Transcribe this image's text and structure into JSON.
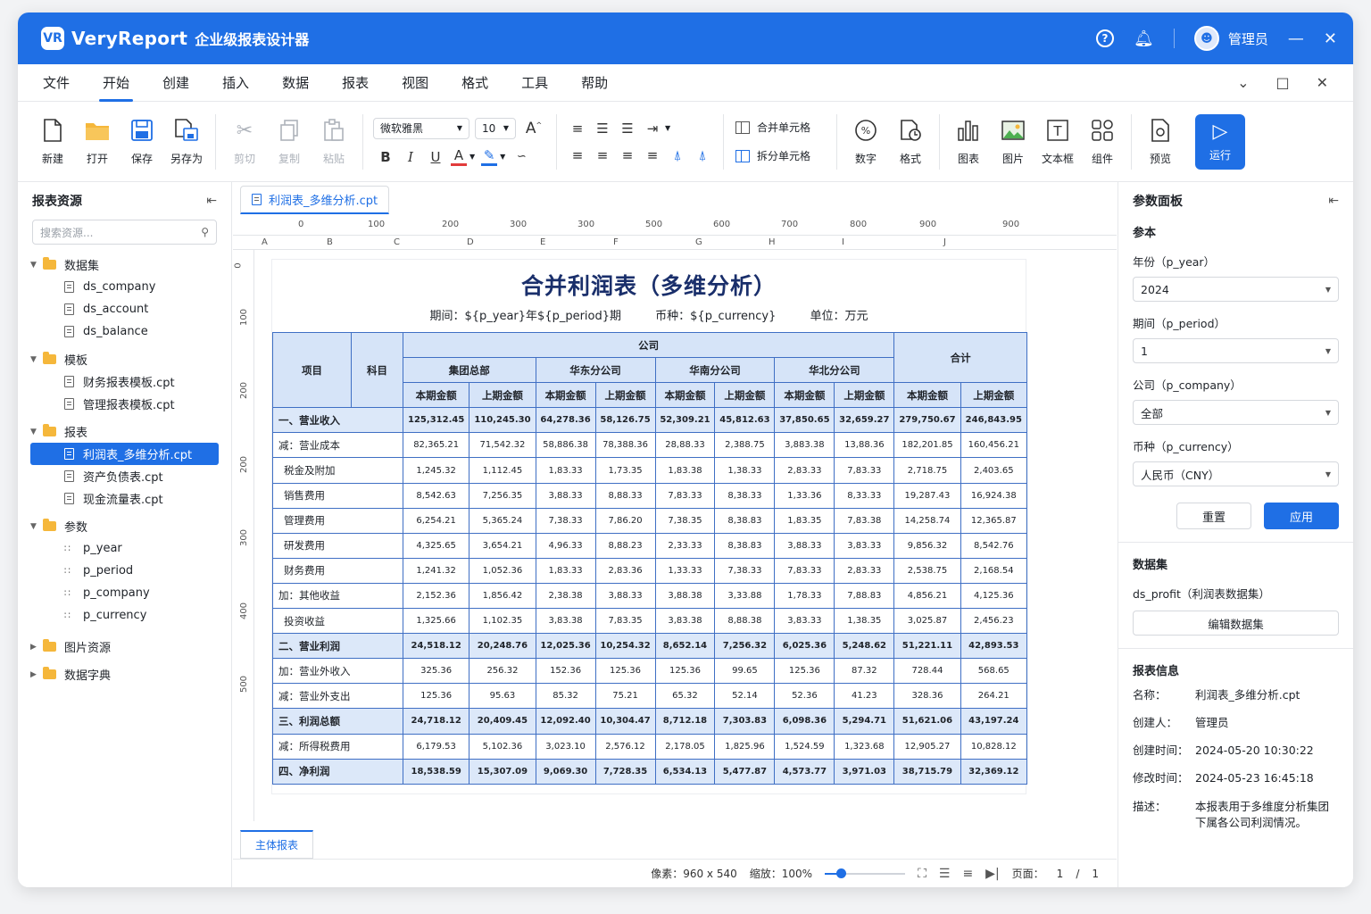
{
  "app": {
    "logo": "VR",
    "name": "VeryReport",
    "subtitle": "企业级报表设计器",
    "user": "管理员"
  },
  "menu": [
    "文件",
    "开始",
    "创建",
    "插入",
    "数据",
    "报表",
    "视图",
    "格式",
    "工具",
    "帮助"
  ],
  "ribbon": {
    "new": "新建",
    "open": "打开",
    "save": "保存",
    "save_as": "另存为",
    "cut": "剪切",
    "copy": "复制",
    "paste": "粘贴",
    "font_family": "微软雅黑",
    "font_size": "10",
    "merge": "合并单元格",
    "split": "拆分单元格",
    "number": "数字",
    "format": "格式",
    "chart": "图表",
    "image": "图片",
    "textbox": "文本框",
    "component": "组件",
    "preview": "预览",
    "run": "运行"
  },
  "left": {
    "title": "报表资源",
    "search_placeholder": "搜索资源...",
    "datasets": {
      "label": "数据集",
      "items": [
        "ds_company",
        "ds_account",
        "ds_balance"
      ]
    },
    "templates": {
      "label": "模板",
      "items": [
        "财务报表模板.cpt",
        "管理报表模板.cpt"
      ]
    },
    "reports": {
      "label": "报表",
      "items": [
        "利润表_多维分析.cpt",
        "资产负债表.cpt",
        "现金流量表.cpt"
      ]
    },
    "params": {
      "label": "参数",
      "items": [
        "p_year",
        "p_period",
        "p_company",
        "p_currency"
      ]
    },
    "images": "图片资源",
    "dict": "数据字典"
  },
  "doc_tab": "利润表_多维分析.cpt",
  "ruler": [
    "0",
    "100",
    "200",
    "300",
    "300",
    "500",
    "600",
    "700",
    "800",
    "900",
    "900"
  ],
  "ruler_v": [
    "0",
    "100",
    "200",
    "200",
    "300",
    "400",
    "500"
  ],
  "columns": [
    "A",
    "B",
    "C",
    "D",
    "E",
    "F",
    "G",
    "H",
    "I",
    "J"
  ],
  "report": {
    "title": "合并利润表（多维分析）",
    "period": "期间：${p_year}年${p_period}期",
    "currency": "币种：${p_currency}",
    "unit": "单位：万元",
    "h_item": "项目",
    "h_subject": "科目",
    "h_company": "公司",
    "h_total": "合计",
    "branches": [
      "集团总部",
      "华东分公司",
      "华南分公司",
      "华北分公司"
    ],
    "cur": "本期金额",
    "prev": "上期金额",
    "rows": [
      {
        "label": "一、营业收入",
        "hl": true,
        "v": [
          "125,312.45",
          "110,245.30",
          "64,278.36",
          "58,126.75",
          "52,309.21",
          "45,812.63",
          "37,850.65",
          "32,659.27",
          "279,750.67",
          "246,843.95"
        ]
      },
      {
        "label": "减：营业成本",
        "v": [
          "82,365.21",
          "71,542.32",
          "58,886.38",
          "78,388.36",
          "28,88.33",
          "2,388.75",
          "3,883.38",
          "13,88.36",
          "182,201.85",
          "160,456.21"
        ]
      },
      {
        "label": "税金及附加",
        "ind": true,
        "v": [
          "1,245.32",
          "1,112.45",
          "1,83.33",
          "1,73.35",
          "1,83.38",
          "1,38.33",
          "2,83.33",
          "7,83.33",
          "2,718.75",
          "2,403.65"
        ]
      },
      {
        "label": "销售费用",
        "ind": true,
        "v": [
          "8,542.63",
          "7,256.35",
          "3,88.33",
          "8,88.33",
          "7,83.33",
          "8,38.33",
          "1,33.36",
          "8,33.33",
          "19,287.43",
          "16,924.38"
        ]
      },
      {
        "label": "管理费用",
        "ind": true,
        "v": [
          "6,254.21",
          "5,365.24",
          "7,38.33",
          "7,86.20",
          "7,38.35",
          "8,38.83",
          "1,83.35",
          "7,83.38",
          "14,258.74",
          "12,365.87"
        ]
      },
      {
        "label": "研发费用",
        "ind": true,
        "v": [
          "4,325.65",
          "3,654.21",
          "4,96.33",
          "8,88.23",
          "2,33.33",
          "8,38.83",
          "3,88.33",
          "3,83.33",
          "9,856.32",
          "8,542.76"
        ]
      },
      {
        "label": "财务费用",
        "ind": true,
        "v": [
          "1,241.32",
          "1,052.36",
          "1,83.33",
          "2,83.36",
          "1,33.33",
          "7,38.33",
          "7,83.33",
          "2,83.33",
          "2,538.75",
          "2,168.54"
        ]
      },
      {
        "label": "加：其他收益",
        "v": [
          "2,152.36",
          "1,856.42",
          "2,38.38",
          "3,88.33",
          "3,88.38",
          "3,33.88",
          "1,78.33",
          "7,88.83",
          "4,856.21",
          "4,125.36"
        ]
      },
      {
        "label": "投资收益",
        "ind": true,
        "v": [
          "1,325.66",
          "1,102.35",
          "3,83.38",
          "7,83.35",
          "3,83.38",
          "8,88.38",
          "3,83.33",
          "1,38.35",
          "3,025.87",
          "2,456.23"
        ]
      },
      {
        "label": "二、营业利润",
        "hl": true,
        "v": [
          "24,518.12",
          "20,248.76",
          "12,025.36",
          "10,254.32",
          "8,652.14",
          "7,256.32",
          "6,025.36",
          "5,248.62",
          "51,221.11",
          "42,893.53"
        ]
      },
      {
        "label": "加：营业外收入",
        "v": [
          "325.36",
          "256.32",
          "152.36",
          "125.36",
          "125.36",
          "99.65",
          "125.36",
          "87.32",
          "728.44",
          "568.65"
        ]
      },
      {
        "label": "减：营业外支出",
        "v": [
          "125.36",
          "95.63",
          "85.32",
          "75.21",
          "65.32",
          "52.14",
          "52.36",
          "41.23",
          "328.36",
          "264.21"
        ]
      },
      {
        "label": "三、利润总额",
        "hl": true,
        "v": [
          "24,718.12",
          "20,409.45",
          "12,092.40",
          "10,304.47",
          "8,712.18",
          "7,303.83",
          "6,098.36",
          "5,294.71",
          "51,621.06",
          "43,197.24"
        ]
      },
      {
        "label": "减：所得税费用",
        "v": [
          "6,179.53",
          "5,102.36",
          "3,023.10",
          "2,576.12",
          "2,178.05",
          "1,825.96",
          "1,524.59",
          "1,323.68",
          "12,905.27",
          "10,828.12"
        ]
      },
      {
        "label": "四、净利润",
        "hl": true,
        "v": [
          "18,538.59",
          "15,307.09",
          "9,069.30",
          "7,728.35",
          "6,534.13",
          "5,477.87",
          "4,573.77",
          "3,971.03",
          "38,715.79",
          "32,369.12"
        ]
      }
    ]
  },
  "sheet_tab": "主体报表",
  "status": {
    "pixels": "像素：960 x 540",
    "zoom_label": "缩放：100%",
    "zoom_level": 0.2,
    "page_label": "页面：",
    "page": "1",
    "slash": "/",
    "total": "1"
  },
  "right": {
    "title": "参数面板",
    "params_title": "参本",
    "year_label": "年份（p_year）",
    "year_value": "2024",
    "period_label": "期间（p_period）",
    "period_value": "1",
    "company_label": "公司（p_company）",
    "company_value": "全部",
    "currency_label": "币种（p_currency）",
    "currency_value": "人民币（CNY）",
    "reset": "重置",
    "apply": "应用",
    "dataset_title": "数据集",
    "dataset_value": "ds_profit（利润表数据集）",
    "edit_dataset": "编辑数据集",
    "info_title": "报表信息",
    "info": [
      {
        "k": "名称：",
        "v": "利润表_多维分析.cpt"
      },
      {
        "k": "创建人：",
        "v": "管理员"
      },
      {
        "k": "创建时间：",
        "v": "2024-05-20 10:30:22"
      },
      {
        "k": "修改时间：",
        "v": "2024-05-23 16:45:18"
      },
      {
        "k": "描述：",
        "v": "本报表用于多维度分析集团下属各公司利润情况。"
      }
    ]
  },
  "colors": {
    "accent": "#1f6fe5",
    "header_fill": "#d6e4f8",
    "title_text": "#1a2f6b"
  }
}
